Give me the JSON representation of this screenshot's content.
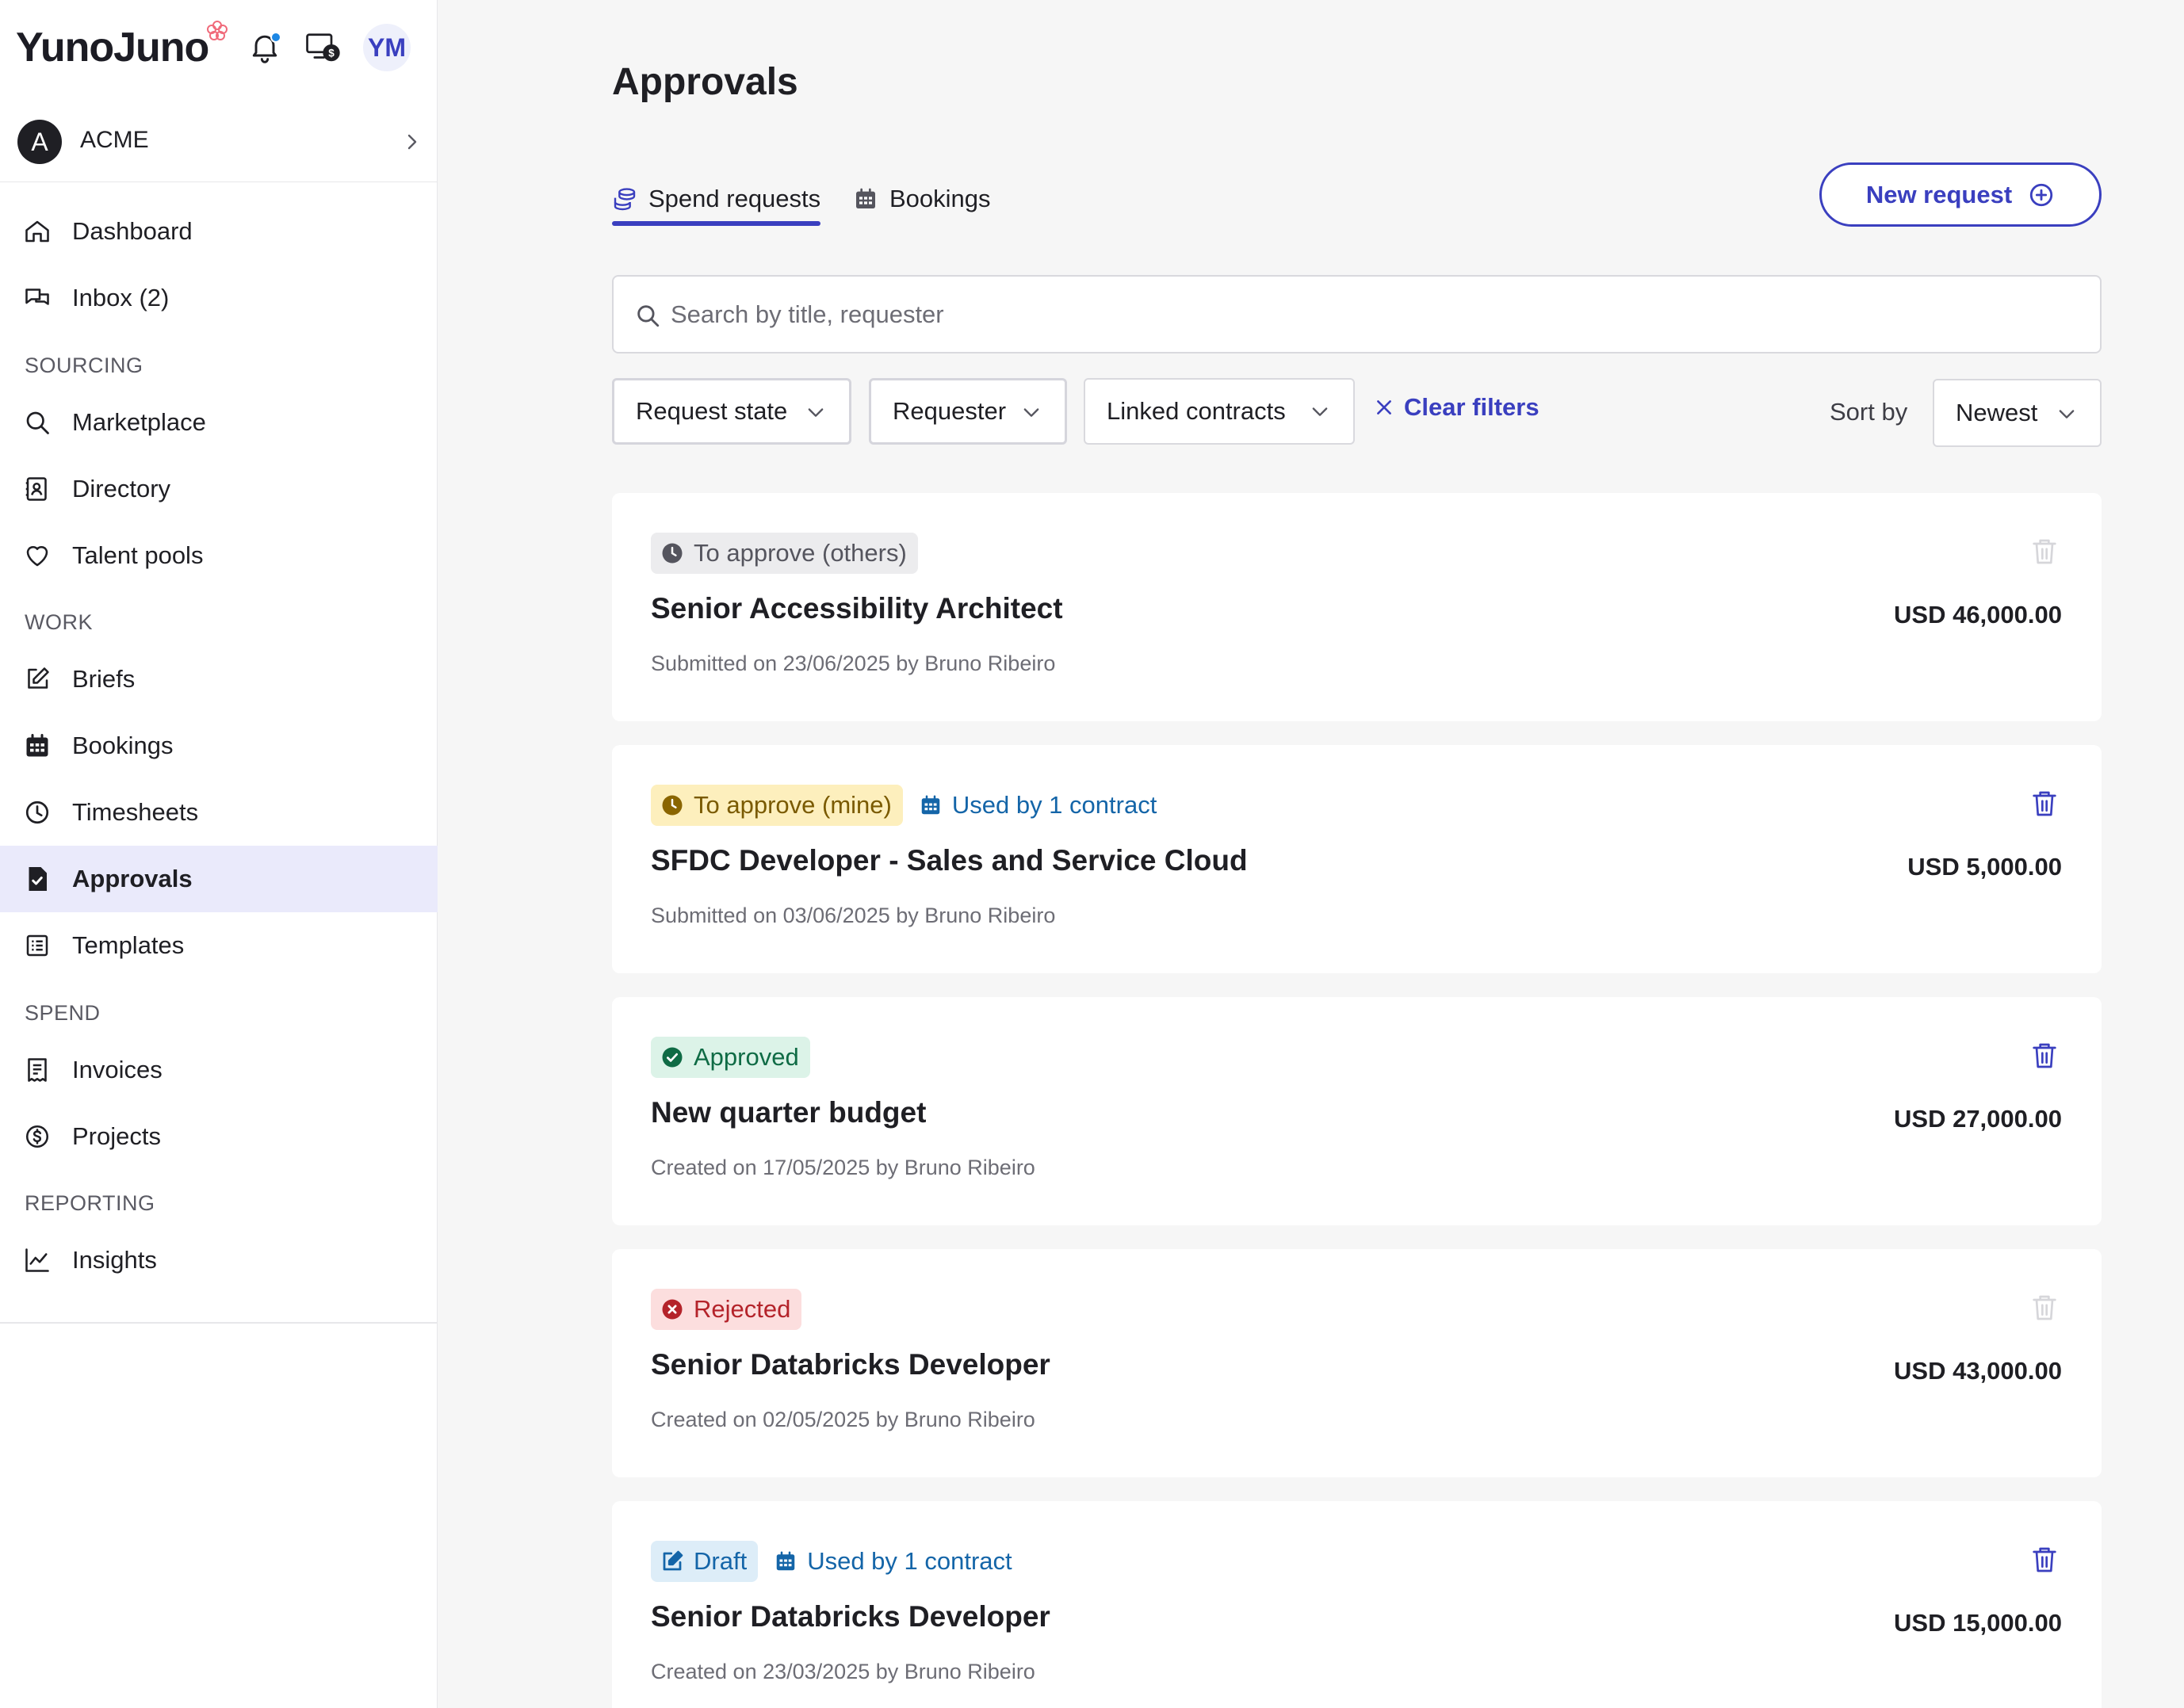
{
  "app": {
    "logo": "YunoJuno",
    "user_initials": "YM"
  },
  "org": {
    "initial": "A",
    "name": "ACME"
  },
  "nav": {
    "dashboard": "Dashboard",
    "inbox": "Inbox (2)",
    "section_sourcing": "SOURCING",
    "marketplace": "Marketplace",
    "directory": "Directory",
    "talent_pools": "Talent pools",
    "section_work": "WORK",
    "briefs": "Briefs",
    "bookings": "Bookings",
    "timesheets": "Timesheets",
    "approvals": "Approvals",
    "templates": "Templates",
    "section_spend": "SPEND",
    "invoices": "Invoices",
    "projects": "Projects",
    "section_reporting": "REPORTING",
    "insights": "Insights",
    "active_item": "approvals"
  },
  "main": {
    "title": "Approvals",
    "tabs": {
      "spend": "Spend requests",
      "bookings": "Bookings",
      "active": "spend"
    },
    "new_request_label": "New request",
    "search": {
      "placeholder": "Search by title, requester",
      "value": ""
    },
    "filters": {
      "request_state": "Request state",
      "requester": "Requester",
      "linked_contracts": "Linked contracts",
      "clear": "Clear filters"
    },
    "sort": {
      "label": "Sort by",
      "value": "Newest"
    },
    "requests": [
      {
        "status": "To approve (others)",
        "linked": "",
        "title": "Senior Accessibility Architect",
        "meta": "Submitted on 23/06/2025 by Bruno Ribeiro",
        "amount": "USD 46,000.00",
        "deletable": false
      },
      {
        "status": "To approve (mine)",
        "linked": "Used by 1 contract",
        "title": "SFDC Developer - Sales and Service Cloud",
        "meta": "Submitted on 03/06/2025 by Bruno Ribeiro",
        "amount": "USD 5,000.00",
        "deletable": true
      },
      {
        "status": "Approved",
        "linked": "",
        "title": "New quarter budget",
        "meta": "Created on 17/05/2025 by Bruno Ribeiro",
        "amount": "USD 27,000.00",
        "deletable": true
      },
      {
        "status": "Rejected",
        "linked": "",
        "title": "Senior Databricks Developer",
        "meta": "Created on 02/05/2025 by Bruno Ribeiro",
        "amount": "USD 43,000.00",
        "deletable": false
      },
      {
        "status": "Draft",
        "linked": "Used by 1 contract",
        "title": "Senior Databricks Developer",
        "meta": "Created on 23/03/2025 by Bruno Ribeiro",
        "amount": "USD 15,000.00",
        "deletable": true
      }
    ]
  },
  "colors": {
    "accent": "#3a3fbf",
    "active_nav_bg": "#eaeafb",
    "badge_pending_others": "#ececee",
    "badge_pending_mine": "#fdefbd",
    "badge_approved": "#dcf3e8",
    "badge_rejected": "#fcdede",
    "badge_draft": "#ddedf8",
    "link_blue": "#1465a8"
  }
}
